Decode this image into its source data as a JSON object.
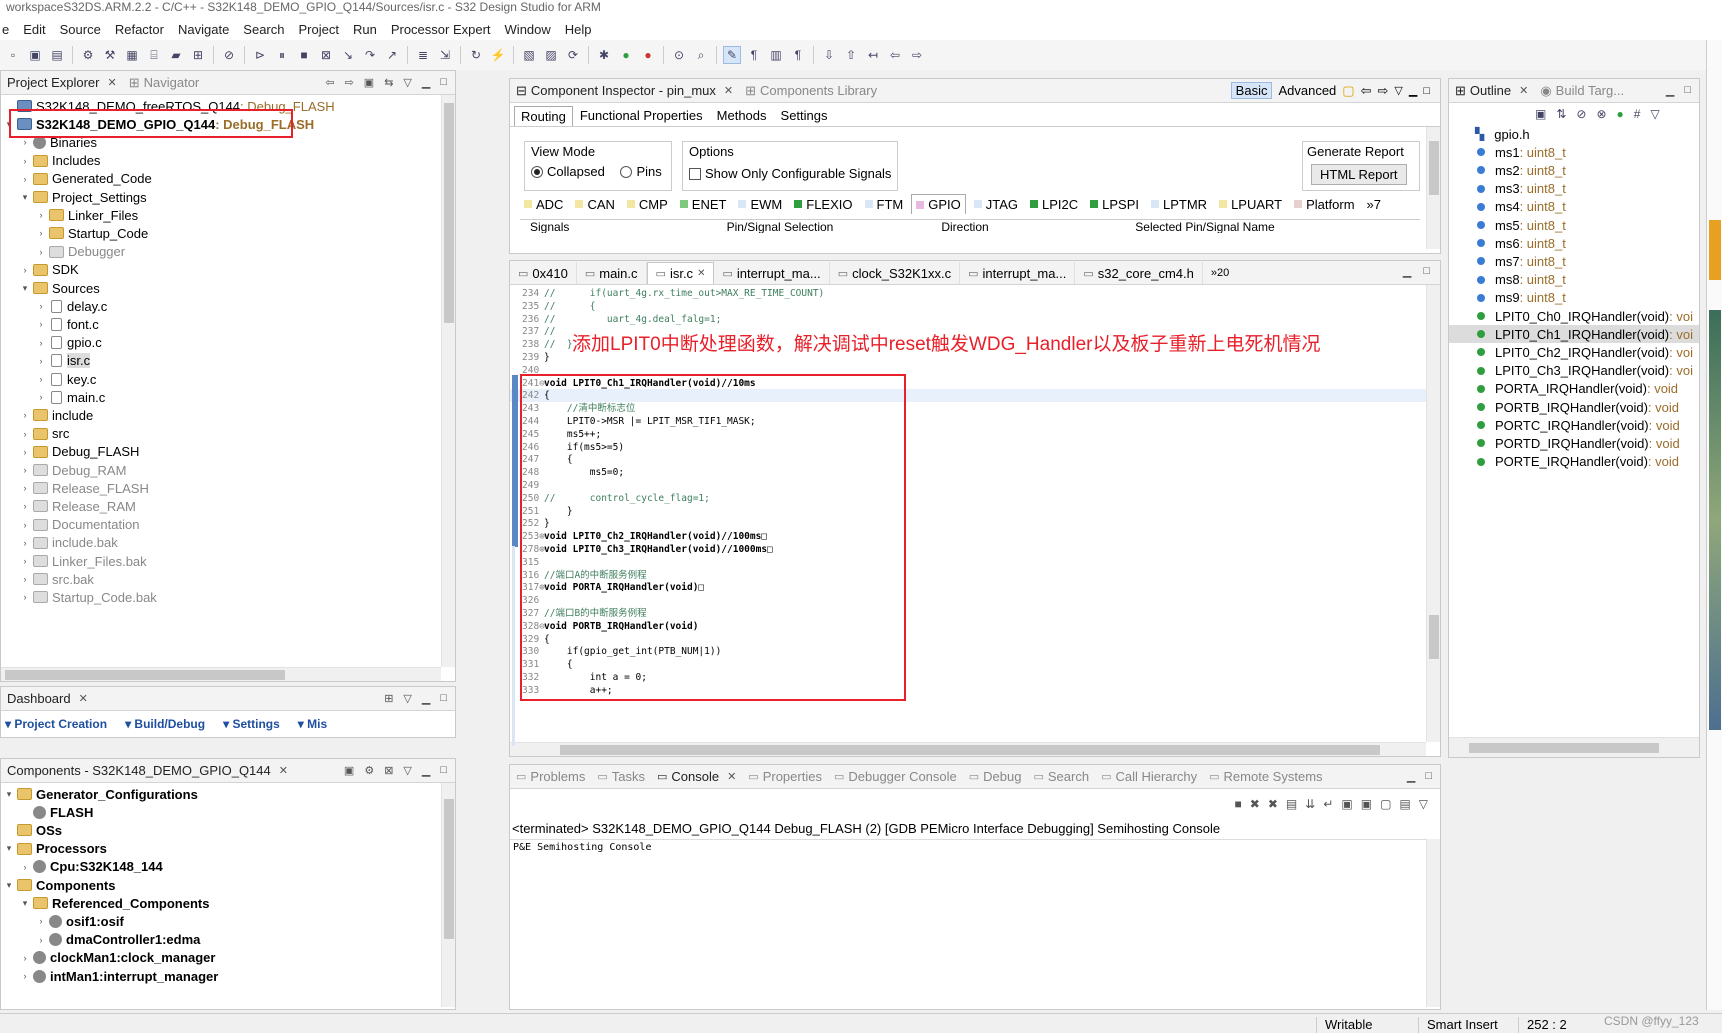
{
  "window_title": "workspaceS32DS.ARM.2.2 - C/C++ - S32K148_DEMO_GPIO_Q144/Sources/isr.c - S32 Design Studio for ARM",
  "menu": [
    "e",
    "Edit",
    "Source",
    "Refactor",
    "Navigate",
    "Search",
    "Project",
    "Run",
    "Processor Expert",
    "Window",
    "Help"
  ],
  "project_explorer": {
    "tab_label": "Project Explorer",
    "navigator_label": "Navigator",
    "items": [
      {
        "name": "S32K148_DEMO_freeRTOS_Q144",
        "suffix": ": Debug_FLASH"
      },
      {
        "name": "S32K148_DEMO_GPIO_Q144",
        "suffix": ": Debug_FLASH"
      },
      {
        "name": "Binaries"
      },
      {
        "name": "Includes"
      },
      {
        "name": "Generated_Code"
      },
      {
        "name": "Project_Settings"
      },
      {
        "name": "Linker_Files"
      },
      {
        "name": "Startup_Code"
      },
      {
        "name": "Debugger"
      },
      {
        "name": "SDK"
      },
      {
        "name": "Sources"
      },
      {
        "name": "delay.c"
      },
      {
        "name": "font.c"
      },
      {
        "name": "gpio.c"
      },
      {
        "name": "isr.c"
      },
      {
        "name": "key.c"
      },
      {
        "name": "main.c"
      },
      {
        "name": "include"
      },
      {
        "name": "src"
      },
      {
        "name": "Debug_FLASH"
      },
      {
        "name": "Debug_RAM"
      },
      {
        "name": "Release_FLASH"
      },
      {
        "name": "Release_RAM"
      },
      {
        "name": "Documentation"
      },
      {
        "name": "include.bak"
      },
      {
        "name": "Linker_Files.bak"
      },
      {
        "name": "src.bak"
      },
      {
        "name": "Startup_Code.bak"
      }
    ]
  },
  "dashboard": {
    "tab_label": "Dashboard",
    "sections": [
      "Project Creation",
      "Build/Debug",
      "Settings",
      "Mis"
    ]
  },
  "components": {
    "tab_label": "Components - S32K148_DEMO_GPIO_Q144",
    "items": [
      {
        "name": "Generator_Configurations"
      },
      {
        "name": "FLASH"
      },
      {
        "name": "OSs"
      },
      {
        "name": "Processors"
      },
      {
        "name": "Cpu:S32K148_144"
      },
      {
        "name": "Components"
      },
      {
        "name": "Referenced_Components"
      },
      {
        "name": "osif1:osif"
      },
      {
        "name": "dmaController1:edma"
      },
      {
        "name": "clockMan1:clock_manager"
      },
      {
        "name": "intMan1:interrupt_manager"
      }
    ]
  },
  "component_inspector": {
    "tab_label": "Component Inspector - pin_mux",
    "library_label": "Components Library",
    "basic_label": "Basic",
    "advanced_label": "Advanced",
    "subtabs": [
      "Routing",
      "Functional Properties",
      "Methods",
      "Settings"
    ],
    "view_mode_label": "View Mode",
    "collapsed_label": "Collapsed",
    "pins_label": "Pins",
    "options_label": "Options",
    "show_only_label": "Show Only Configurable Signals",
    "generate_report_label": "Generate Report",
    "html_report_label": "HTML Report",
    "peripheral_tabs": [
      {
        "label": "ADC",
        "color": "#f2e6a0"
      },
      {
        "label": "CAN",
        "color": "#f2e6a0"
      },
      {
        "label": "CMP",
        "color": "#f2e6a0"
      },
      {
        "label": "ENET",
        "color": "#7fc97f"
      },
      {
        "label": "EWM",
        "color": "#d8e6f5"
      },
      {
        "label": "FLEXIO",
        "color": "#2e9e3e"
      },
      {
        "label": "FTM",
        "color": "#d8e6f5"
      },
      {
        "label": "GPIO",
        "color": "#e7b8e0"
      },
      {
        "label": "JTAG",
        "color": "#d8e6f5"
      },
      {
        "label": "LPI2C",
        "color": "#2e9e3e"
      },
      {
        "label": "LPSPI",
        "color": "#2e9e3e"
      },
      {
        "label": "LPTMR",
        "color": "#d8e6f5"
      },
      {
        "label": "LPUART",
        "color": "#f2e6a0"
      },
      {
        "label": "Platform",
        "color": "#e8d0d0"
      }
    ],
    "overflow_label": "»7",
    "columns": [
      "Signals",
      "Pin/Signal Selection",
      "Direction",
      "Selected Pin/Signal Name"
    ]
  },
  "editor": {
    "tabs": [
      "0x410",
      "main.c",
      "isr.c",
      "interrupt_ma...",
      "clock_S32K1xx.c",
      "interrupt_ma...",
      "s32_core_cm4.h"
    ],
    "overflow_label": "»20",
    "annotation": "添加LPIT0中断处理函数，解决调试中reset触发WDG_Handler以及板子重新上电死机情况",
    "lines": [
      {
        "n": "234",
        "text": "//      if(uart_4g.rx_time_out>MAX_RE_TIME_COUNT)",
        "type": "comment"
      },
      {
        "n": "235",
        "text": "//      {",
        "type": "comment"
      },
      {
        "n": "236",
        "text": "//         uart_4g.deal_falg=1;",
        "type": "comment"
      },
      {
        "n": "237",
        "text": "//",
        "type": "comment"
      },
      {
        "n": "238",
        "text": "//  }",
        "type": "comment"
      },
      {
        "n": "239",
        "text": "}",
        "type": "code"
      },
      {
        "n": "240",
        "text": "",
        "type": "code"
      },
      {
        "n": "241⊖",
        "text": "void LPIT0_Ch1_IRQHandler(void)//10ms",
        "type": "fn"
      },
      {
        "n": "242",
        "text": "{",
        "type": "code"
      },
      {
        "n": "243",
        "text": "    //清中断标志位",
        "type": "comment"
      },
      {
        "n": "244",
        "text": "    LPIT0->MSR |= LPIT_MSR_TIF1_MASK;",
        "type": "code"
      },
      {
        "n": "245",
        "text": "    ms5++;",
        "type": "code"
      },
      {
        "n": "246",
        "text": "    if(ms5>=5)",
        "type": "code"
      },
      {
        "n": "247",
        "text": "    {",
        "type": "code"
      },
      {
        "n": "248",
        "text": "        ms5=0;",
        "type": "code"
      },
      {
        "n": "249",
        "text": "",
        "type": "code"
      },
      {
        "n": "250",
        "text": "//      control_cycle_flag=1;",
        "type": "comment"
      },
      {
        "n": "251",
        "text": "    }",
        "type": "code"
      },
      {
        "n": "252",
        "text": "}",
        "type": "code"
      },
      {
        "n": "253⊕",
        "text": "void LPIT0_Ch2_IRQHandler(void)//100ms□",
        "type": "fn"
      },
      {
        "n": "278⊕",
        "text": "void LPIT0_Ch3_IRQHandler(void)//1000ms□",
        "type": "fn"
      },
      {
        "n": "315",
        "text": "",
        "type": "code"
      },
      {
        "n": "316",
        "text": "//端口A的中断服务例程",
        "type": "comment"
      },
      {
        "n": "317⊕",
        "text": "void PORTA_IRQHandler(void)□",
        "type": "fn"
      },
      {
        "n": "326",
        "text": "",
        "type": "code"
      },
      {
        "n": "327",
        "text": "//端口B的中断服务例程",
        "type": "comment"
      },
      {
        "n": "328⊖",
        "text": "void PORTB_IRQHandler(void)",
        "type": "fn"
      },
      {
        "n": "329",
        "text": "{",
        "type": "code"
      },
      {
        "n": "330",
        "text": "    if(gpio_get_int(PTB_NUM|1))",
        "type": "code"
      },
      {
        "n": "331",
        "text": "    {",
        "type": "code"
      },
      {
        "n": "332",
        "text": "        int a = 0;",
        "type": "code"
      },
      {
        "n": "333",
        "text": "        a++;",
        "type": "code"
      }
    ]
  },
  "outline": {
    "tab_label": "Outline",
    "build_label": "Build Targ...",
    "items": [
      {
        "name": "gpio.h",
        "type": ""
      },
      {
        "name": "ms1",
        "type": " : uint8_t"
      },
      {
        "name": "ms2",
        "type": " : uint8_t"
      },
      {
        "name": "ms3",
        "type": " : uint8_t"
      },
      {
        "name": "ms4",
        "type": " : uint8_t"
      },
      {
        "name": "ms5",
        "type": " : uint8_t"
      },
      {
        "name": "ms6",
        "type": " : uint8_t"
      },
      {
        "name": "ms7",
        "type": " : uint8_t"
      },
      {
        "name": "ms8",
        "type": " : uint8_t"
      },
      {
        "name": "ms9",
        "type": " : uint8_t"
      },
      {
        "name": "LPIT0_Ch0_IRQHandler(void)",
        "type": " : voi"
      },
      {
        "name": "LPIT0_Ch1_IRQHandler(void)",
        "type": " : voi"
      },
      {
        "name": "LPIT0_Ch2_IRQHandler(void)",
        "type": " : voi"
      },
      {
        "name": "LPIT0_Ch3_IRQHandler(void)",
        "type": " : voi"
      },
      {
        "name": "PORTA_IRQHandler(void)",
        "type": " : void"
      },
      {
        "name": "PORTB_IRQHandler(void)",
        "type": " : void"
      },
      {
        "name": "PORTC_IRQHandler(void)",
        "type": " : void"
      },
      {
        "name": "PORTD_IRQHandler(void)",
        "type": " : void"
      },
      {
        "name": "PORTE_IRQHandler(void)",
        "type": " : void"
      }
    ]
  },
  "console": {
    "tabs": [
      "Problems",
      "Tasks",
      "Console",
      "Properties",
      "Debugger Console",
      "Debug",
      "Search",
      "Call Hierarchy",
      "Remote Systems"
    ],
    "header": "<terminated> S32K148_DEMO_GPIO_Q144 Debug_FLASH (2) [GDB PEMicro Interface Debugging] Semihosting Console",
    "body": "P&E Semihosting Console"
  },
  "status": {
    "writable": "Writable",
    "insert_mode": "Smart Insert",
    "position": "252 : 2",
    "watermark": "CSDN @ffyy_123"
  }
}
